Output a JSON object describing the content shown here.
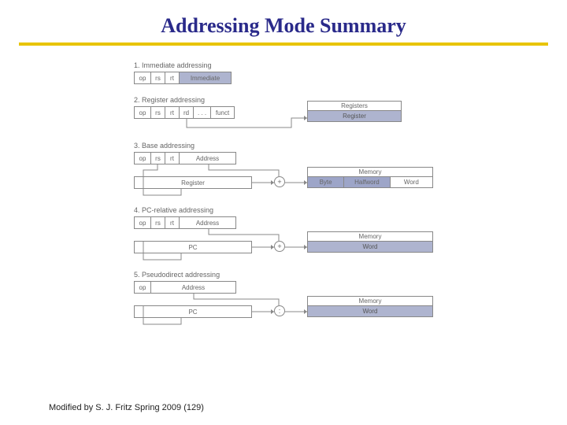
{
  "title": "Addressing Mode Summary",
  "footer": "Modified by S. J. Fritz  Spring 2009 (129)",
  "modes": {
    "m1": {
      "label": "1.  Immediate addressing",
      "fields": {
        "op": "op",
        "rs": "rs",
        "rt": "rt",
        "imm": "Immediate"
      }
    },
    "m2": {
      "label": "2.  Register addressing",
      "fields": {
        "op": "op",
        "rs": "rs",
        "rt": "rt",
        "rd": "rd",
        "dots": ". . .",
        "funct": "funct"
      },
      "box": {
        "hdr": "Registers",
        "body": "Register"
      }
    },
    "m3": {
      "label": "3.  Base addressing",
      "fields": {
        "op": "op",
        "rs": "rs",
        "rt": "rt",
        "addr": "Address"
      },
      "reg": "Register",
      "op_sym": "+",
      "box": {
        "hdr": "Memory",
        "byte": "Byte",
        "half": "Halfword",
        "word": "Word"
      }
    },
    "m4": {
      "label": "4.  PC-relative addressing",
      "fields": {
        "op": "op",
        "rs": "rs",
        "rt": "rt",
        "addr": "Address"
      },
      "reg": "PC",
      "op_sym": "+",
      "box": {
        "hdr": "Memory",
        "body": "Word"
      }
    },
    "m5": {
      "label": "5.  Pseudodirect addressing",
      "fields": {
        "op": "op",
        "addr": "Address"
      },
      "reg": "PC",
      "op_sym": ":",
      "box": {
        "hdr": "Memory",
        "body": "Word"
      }
    }
  }
}
